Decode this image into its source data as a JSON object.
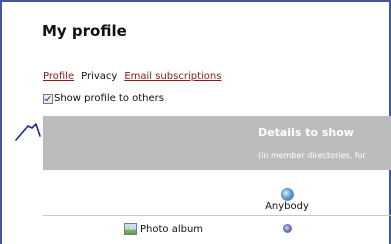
{
  "page": {
    "title": "My profile"
  },
  "tabs": {
    "profile": "Profile",
    "privacy": "Privacy",
    "email_subscriptions": "Email subscriptions"
  },
  "show_profile": {
    "label": "Show profile to others",
    "checked": true
  },
  "details": {
    "title": "Details to show",
    "subtitle": "(in member directories, for"
  },
  "columns": {
    "anybody": "Anybody"
  },
  "rows": {
    "photo_album": "Photo album"
  },
  "colors": {
    "frame_border": "#3d5aa0",
    "link": "#8b1a1a",
    "header_bg": "#bcbcbc",
    "pen_mark": "#1a2d8a"
  },
  "icons": {
    "globe": "globe-icon",
    "photo": "photo-album-icon",
    "radio": "radio-selected-icon"
  }
}
